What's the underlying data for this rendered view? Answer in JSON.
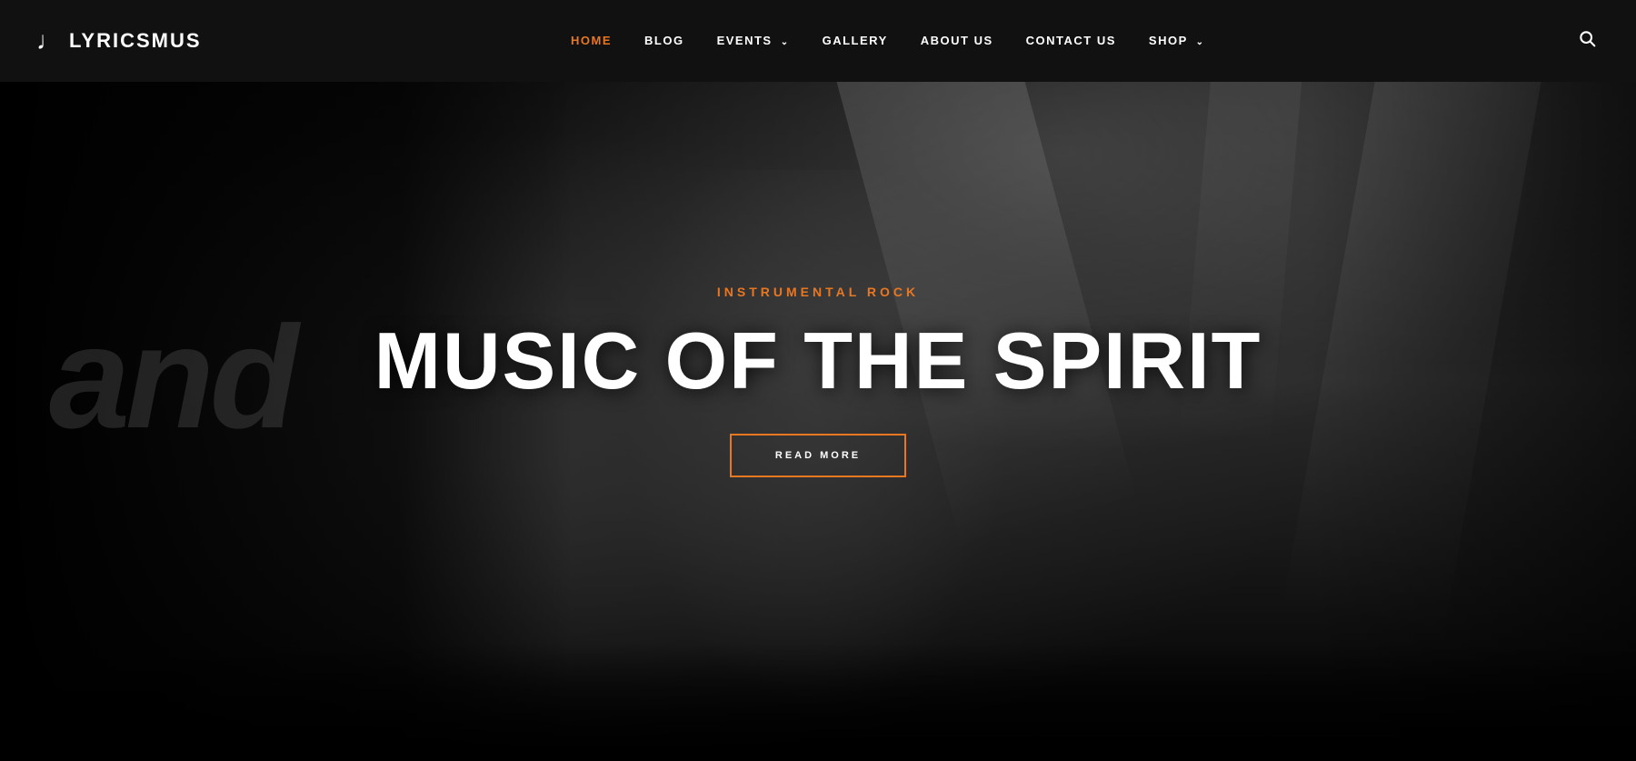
{
  "brand": {
    "icon": "♩",
    "name": "LYRICSMUS"
  },
  "nav": {
    "items": [
      {
        "label": "HOME",
        "active": true,
        "dropdown": false
      },
      {
        "label": "BLOG",
        "active": false,
        "dropdown": false
      },
      {
        "label": "EVENTS",
        "active": false,
        "dropdown": true
      },
      {
        "label": "GALLERY",
        "active": false,
        "dropdown": false
      },
      {
        "label": "ABOUT US",
        "active": false,
        "dropdown": false
      },
      {
        "label": "CONTACT US",
        "active": false,
        "dropdown": false
      },
      {
        "label": "SHOP",
        "active": false,
        "dropdown": true
      }
    ],
    "search_icon": "search"
  },
  "hero": {
    "subtitle": "INSTRUMENTAL ROCK",
    "title": "MUSIC OF THE SPIRIT",
    "cta_label": "READ MORE"
  },
  "colors": {
    "accent": "#e87722",
    "bg": "#111111",
    "text": "#ffffff"
  }
}
